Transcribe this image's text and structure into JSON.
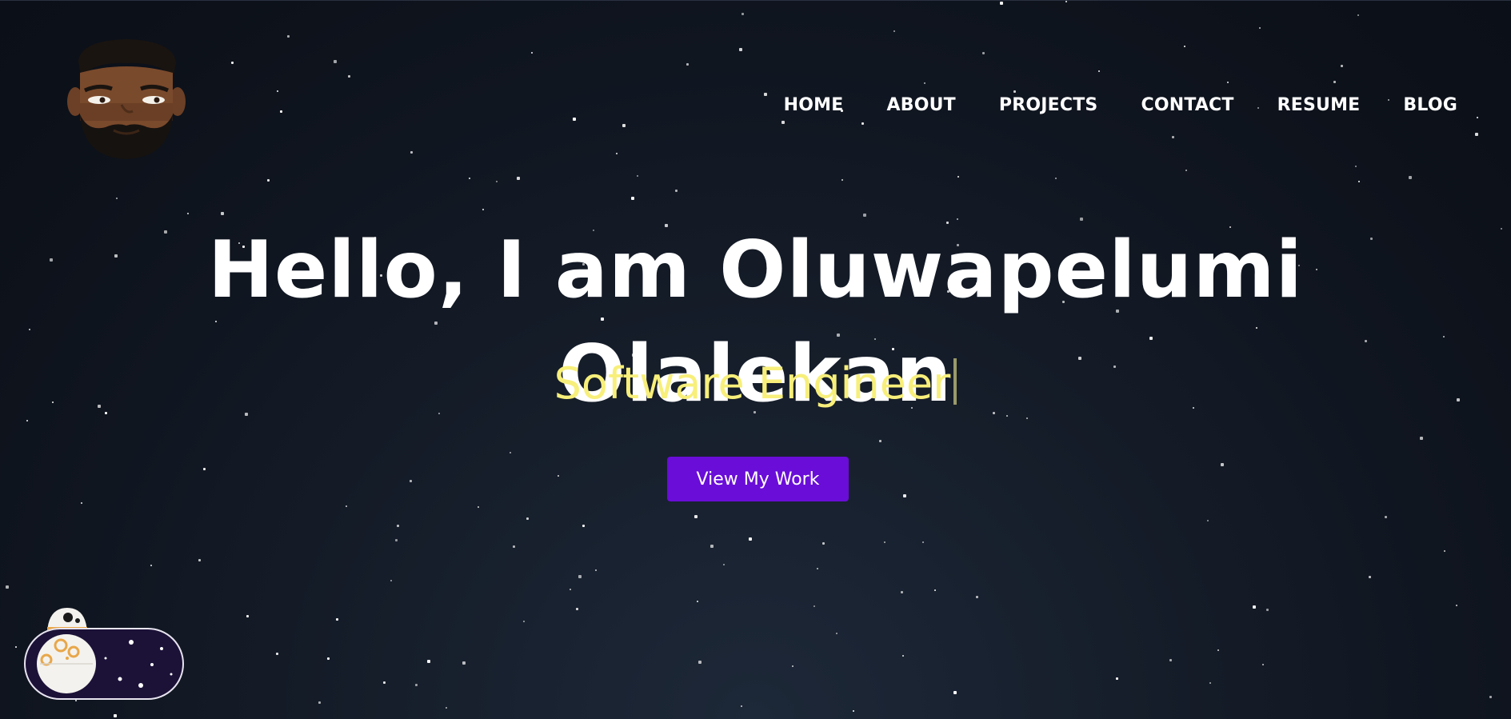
{
  "nav": {
    "items": [
      {
        "label": "HOME"
      },
      {
        "label": "ABOUT"
      },
      {
        "label": "PROJECTS"
      },
      {
        "label": "CONTACT"
      },
      {
        "label": "RESUME"
      },
      {
        "label": "BLOG"
      }
    ]
  },
  "hero": {
    "title": "Hello, I am Oluwapelumi Olalekan",
    "subtitle": "Software Engineer",
    "cta_label": "View My Work"
  },
  "theme_toggle": {
    "mode": "dark"
  },
  "colors": {
    "background": "#0d1117",
    "subtitle": "#f7ef7a",
    "cta": "#6a0dd8",
    "nav_text": "#ffffff"
  }
}
